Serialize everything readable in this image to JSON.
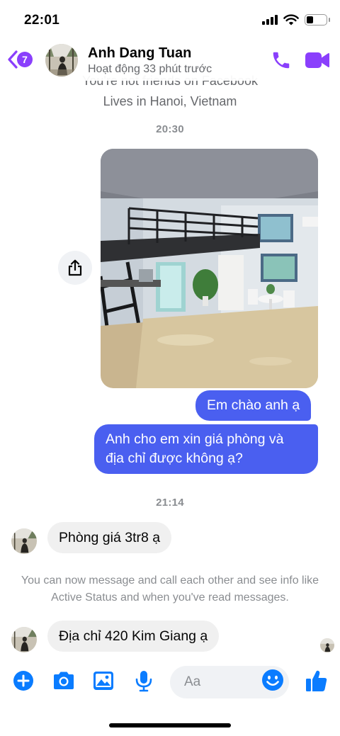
{
  "status_bar": {
    "time": "22:01"
  },
  "header": {
    "unread_count": "7",
    "contact_name": "Anh Dang Tuan",
    "activity": "Hoạt động 33 phút trước"
  },
  "profile_info": {
    "not_friends": "You're not friends on Facebook",
    "location": "Lives in Hanoi, Vietnam"
  },
  "messages": {
    "time_1": "20:30",
    "out_1": "Em chào anh ạ",
    "out_2_line1": "Anh cho em xin giá phòng và",
    "out_2_line2": "địa chỉ được không ạ?",
    "time_2": "21:14",
    "in_1": "Phòng giá 3tr8 ạ",
    "notice": "You can now message and call each other and see info like Active Status and when you've read messages.",
    "in_2": "Địa chỉ 420 Kim Giang ạ"
  },
  "composer": {
    "placeholder": "Aa"
  },
  "colors": {
    "accent": "#8a3ffc",
    "outgoing_bubble": "#4a5ff0",
    "composer_icon": "#0a7cff"
  }
}
